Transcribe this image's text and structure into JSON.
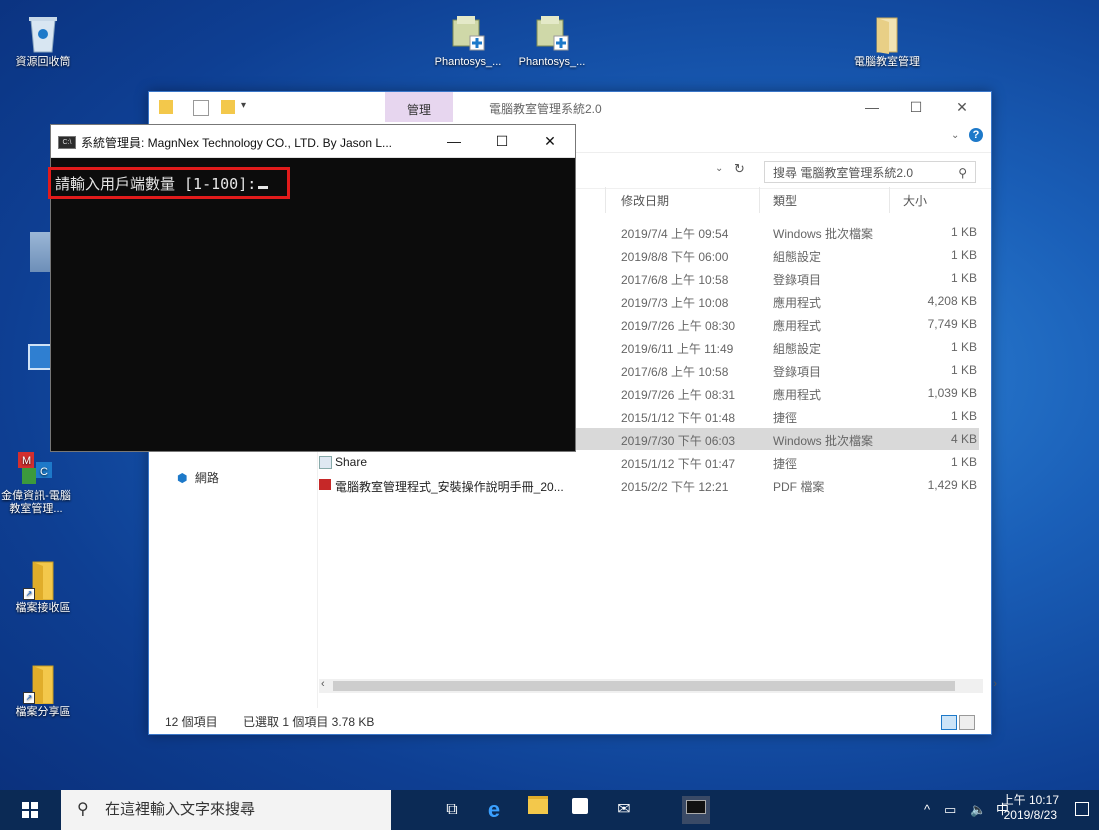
{
  "desktop": {
    "icons": [
      {
        "label": "資源回收筒"
      },
      {
        "label": "Phantosys_..."
      },
      {
        "label": "Phantosys_..."
      },
      {
        "label": "電腦教室管理"
      },
      {
        "label": "金偉資訊-電腦教室管理..."
      },
      {
        "label": "檔案接收區"
      },
      {
        "label": "檔案分享區"
      }
    ]
  },
  "explorer": {
    "tab_manage": "管理",
    "title": "電腦教室管理系統2.0",
    "search_placeholder": "搜尋 電腦教室管理系統2.0",
    "columns": {
      "date": "修改日期",
      "type": "類型",
      "size": "大小"
    },
    "rows": [
      {
        "name": "",
        "date": "2019/7/4 上午 09:54",
        "type": "Windows 批次檔案",
        "size": "1 KB"
      },
      {
        "name": "",
        "date": "2019/8/8 下午 06:00",
        "type": "組態設定",
        "size": "1 KB"
      },
      {
        "name": "",
        "date": "2017/6/8 上午 10:58",
        "type": "登錄項目",
        "size": "1 KB"
      },
      {
        "name": "",
        "date": "2019/7/3 上午 10:08",
        "type": "應用程式",
        "size": "4,208 KB"
      },
      {
        "name": "",
        "date": "2019/7/26 上午 08:30",
        "type": "應用程式",
        "size": "7,749 KB"
      },
      {
        "name": "",
        "date": "2019/6/11 上午 11:49",
        "type": "組態設定",
        "size": "1 KB"
      },
      {
        "name": "",
        "date": "2017/6/8 上午 10:58",
        "type": "登錄項目",
        "size": "1 KB"
      },
      {
        "name": "",
        "date": "2019/7/26 上午 08:31",
        "type": "應用程式",
        "size": "1,039 KB"
      },
      {
        "name": "",
        "date": "2015/1/12 下午 01:48",
        "type": "捷徑",
        "size": "1 KB"
      },
      {
        "name": "",
        "date": "2019/7/30 下午 06:03",
        "type": "Windows 批次檔案",
        "size": "4 KB"
      },
      {
        "name": "Share",
        "date": "2015/1/12 下午 01:47",
        "type": "捷徑",
        "size": "1 KB"
      },
      {
        "name": "電腦教室管理程式_安裝操作說明手冊_20...",
        "date": "2015/2/2 下午 12:21",
        "type": "PDF 檔案",
        "size": "1,429 KB"
      }
    ],
    "nav_network": "網路",
    "status_items": "12 個項目",
    "status_selected": "已選取 1 個項目 3.78 KB"
  },
  "console": {
    "title": "系統管理員: MagnNex Technology CO., LTD. By Jason L...",
    "prompt": "請輸入用戶端數量 [1-100]:"
  },
  "taskbar": {
    "search_placeholder": "在這裡輸入文字來搜尋",
    "tray_ime": "中",
    "time": "上午 10:17",
    "date": "2019/8/23"
  },
  "colors": {
    "accent": "#0078d7",
    "highlight": "#e21b1b",
    "manage_tab": "#e7d6ef"
  }
}
